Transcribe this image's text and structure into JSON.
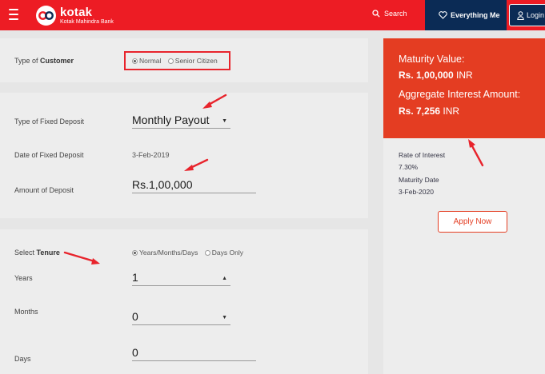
{
  "header": {
    "logo_name": "kotak",
    "logo_sub": "Kotak Mahindra Bank",
    "search_label": "Search",
    "everything_label": "Everything Me",
    "login_label": "Login"
  },
  "customer": {
    "label_prefix": "Type of ",
    "label_bold": "Customer",
    "options": [
      "Normal",
      "Senior Citizen"
    ],
    "selected": "Normal"
  },
  "deposit": {
    "type_label": "Type of Fixed Deposit",
    "type_value": "Monthly Payout",
    "date_label": "Date of Fixed Deposit",
    "date_value": "3-Feb-2019",
    "amount_label": "Amount of Deposit",
    "amount_value": "Rs.1,00,000"
  },
  "tenure": {
    "label_prefix": "Select ",
    "label_bold": "Tenure",
    "options": [
      "Years/Months/Days",
      "Days Only"
    ],
    "selected": "Years/Months/Days",
    "years_label": "Years",
    "years_value": "1",
    "months_label": "Months",
    "months_value": "0",
    "days_label": "Days",
    "days_value": "0"
  },
  "summary": {
    "maturity_label": "Maturity Value:",
    "maturity_value": "Rs. 1,00,000",
    "maturity_unit": " INR",
    "interest_label": "Aggregate Interest Amount:",
    "interest_value": "Rs. 7,256",
    "interest_unit": " INR",
    "rate_label": "Rate of Interest",
    "rate_value": "7.30%",
    "maturity_date_label": "Maturity Date",
    "maturity_date_value": "3-Feb-2020",
    "apply_label": "Apply Now"
  },
  "colors": {
    "header_red": "#ed1c24",
    "nav_blue": "#0b2b55",
    "summary_orange": "#e43d22",
    "annotation_red": "#e8242c"
  }
}
